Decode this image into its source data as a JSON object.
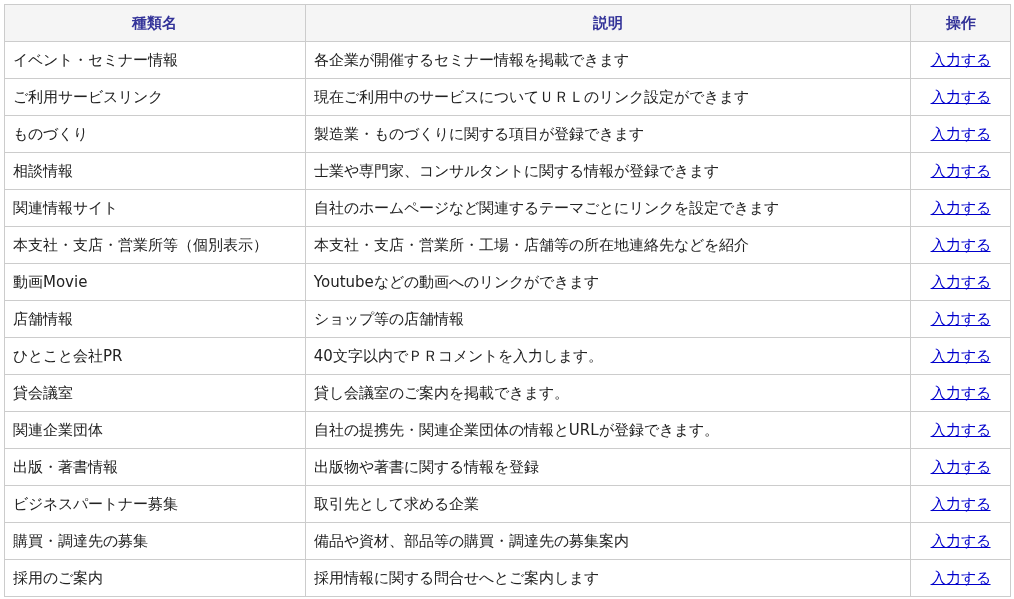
{
  "table": {
    "columns": [
      "種類名",
      "説明",
      "操作"
    ],
    "rows": [
      {
        "name": "イベント・セミナー情報",
        "description": "各企業が開催するセミナー情報を掲載できます",
        "action": "入力する"
      },
      {
        "name": "ご利用サービスリンク",
        "description": "現在ご利用中のサービスについてＵＲＬのリンク設定ができます",
        "action": "入力する"
      },
      {
        "name": "ものづくり",
        "description": "製造業・ものづくりに関する項目が登録できます",
        "action": "入力する"
      },
      {
        "name": "相談情報",
        "description": "士業や専門家、コンサルタントに関する情報が登録できます",
        "action": "入力する"
      },
      {
        "name": "関連情報サイト",
        "description": "自社のホームページなど関連するテーマごとにリンクを設定できます",
        "action": "入力する"
      },
      {
        "name": "本支社・支店・営業所等（個別表示）",
        "description": "本支社・支店・営業所・工場・店舗等の所在地連絡先などを紹介",
        "action": "入力する"
      },
      {
        "name": "動画Movie",
        "description": "Youtubeなどの動画へのリンクができます",
        "action": "入力する"
      },
      {
        "name": "店舗情報",
        "description": "ショップ等の店舗情報",
        "action": "入力する"
      },
      {
        "name": "ひとこと会社PR",
        "description": "40文字以内でＰＲコメントを入力します。",
        "action": "入力する"
      },
      {
        "name": "貸会議室",
        "description": "貸し会議室のご案内を掲載できます。",
        "action": "入力する"
      },
      {
        "name": "関連企業団体",
        "description": "自社の提携先・関連企業団体の情報とURLが登録できます。",
        "action": "入力する"
      },
      {
        "name": "出版・著書情報",
        "description": "出版物や著書に関する情報を登録",
        "action": "入力する"
      },
      {
        "name": "ビジネスパートナー募集",
        "description": "取引先として求める企業",
        "action": "入力する"
      },
      {
        "name": "購買・調達先の募集",
        "description": "備品や資材、部品等の購買・調達先の募集案内",
        "action": "入力する"
      },
      {
        "name": "採用のご案内",
        "description": "採用情報に関する問合せへとご案内します",
        "action": "入力する"
      }
    ]
  }
}
